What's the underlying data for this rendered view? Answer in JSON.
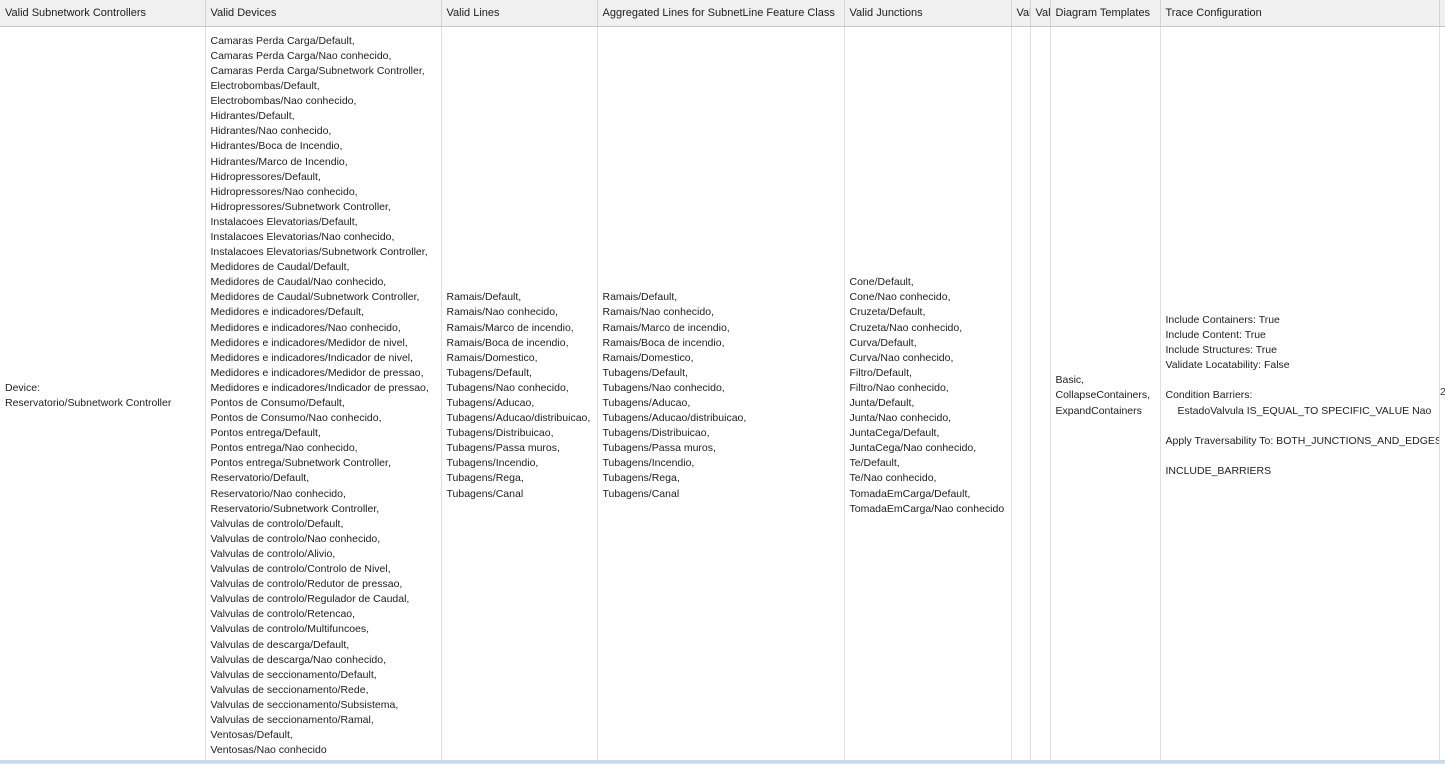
{
  "columns": [
    "Valid Subnetwork Controllers",
    "Valid Devices",
    "Valid Lines",
    "Aggregated Lines for SubnetLine Feature Class",
    "Valid Junctions",
    "Val",
    "Val",
    "Diagram Templates",
    "Trace Configuration",
    ""
  ],
  "row": {
    "subnetwork_controllers": [
      "Device:",
      "Reservatorio/Subnetwork Controller"
    ],
    "valid_devices": [
      "Camaras Perda Carga/Default,",
      "Camaras Perda Carga/Nao conhecido,",
      "Camaras Perda Carga/Subnetwork Controller,",
      "Electrobombas/Default,",
      "Electrobombas/Nao conhecido,",
      "Hidrantes/Default,",
      "Hidrantes/Nao conhecido,",
      "Hidrantes/Boca de Incendio,",
      "Hidrantes/Marco de Incendio,",
      "Hidropressores/Default,",
      "Hidropressores/Nao conhecido,",
      "Hidropressores/Subnetwork Controller,",
      "Instalacoes Elevatorias/Default,",
      "Instalacoes Elevatorias/Nao conhecido,",
      "Instalacoes Elevatorias/Subnetwork Controller,",
      "Medidores de Caudal/Default,",
      "Medidores de Caudal/Nao conhecido,",
      "Medidores de Caudal/Subnetwork Controller,",
      "Medidores e indicadores/Default,",
      "Medidores e indicadores/Nao conhecido,",
      "Medidores e indicadores/Medidor de nivel,",
      "Medidores e indicadores/Indicador de nivel,",
      "Medidores e indicadores/Medidor de pressao,",
      "Medidores e indicadores/Indicador de pressao,",
      "Pontos de Consumo/Default,",
      "Pontos de Consumo/Nao conhecido,",
      "Pontos entrega/Default,",
      "Pontos entrega/Nao conhecido,",
      "Pontos entrega/Subnetwork Controller,",
      "Reservatorio/Default,",
      "Reservatorio/Nao conhecido,",
      "Reservatorio/Subnetwork Controller,",
      "Valvulas de controlo/Default,",
      "Valvulas de controlo/Nao conhecido,",
      "Valvulas de controlo/Alivio,",
      "Valvulas de controlo/Controlo de Nivel,",
      "Valvulas de controlo/Redutor de pressao,",
      "Valvulas de controlo/Regulador de Caudal,",
      "Valvulas de controlo/Retencao,",
      "Valvulas de controlo/Multifuncoes,",
      "Valvulas de descarga/Default,",
      "Valvulas de descarga/Nao conhecido,",
      "Valvulas de seccionamento/Default,",
      "Valvulas de seccionamento/Rede,",
      "Valvulas de seccionamento/Subsistema,",
      "Valvulas de seccionamento/Ramal,",
      "Ventosas/Default,",
      "Ventosas/Nao conhecido"
    ],
    "valid_lines": [
      "Ramais/Default,",
      "Ramais/Nao conhecido,",
      "Ramais/Marco de incendio,",
      "Ramais/Boca de incendio,",
      "Ramais/Domestico,",
      "Tubagens/Default,",
      "Tubagens/Nao conhecido,",
      "Tubagens/Aducao,",
      "Tubagens/Aducao/distribuicao,",
      "Tubagens/Distribuicao,",
      "Tubagens/Passa muros,",
      "Tubagens/Incendio,",
      "Tubagens/Rega,",
      "Tubagens/Canal"
    ],
    "aggregated_lines": [
      "Ramais/Default,",
      "Ramais/Nao conhecido,",
      "Ramais/Marco de incendio,",
      "Ramais/Boca de incendio,",
      "Ramais/Domestico,",
      "Tubagens/Default,",
      "Tubagens/Nao conhecido,",
      "Tubagens/Aducao,",
      "Tubagens/Aducao/distribuicao,",
      "Tubagens/Distribuicao,",
      "Tubagens/Passa muros,",
      "Tubagens/Incendio,",
      "Tubagens/Rega,",
      "Tubagens/Canal"
    ],
    "valid_junctions": [
      "Cone/Default,",
      "Cone/Nao conhecido,",
      "Cruzeta/Default,",
      "Cruzeta/Nao conhecido,",
      "Curva/Default,",
      "Curva/Nao conhecido,",
      "Filtro/Default,",
      "Filtro/Nao conhecido,",
      "Junta/Default,",
      "Junta/Nao conhecido,",
      "JuntaCega/Default,",
      "JuntaCega/Nao conhecido,",
      "Te/Default,",
      "Te/Nao conhecido,",
      "TomadaEmCarga/Default,",
      "TomadaEmCarga/Nao conhecido"
    ],
    "diagram_templates": [
      "Basic,",
      "CollapseContainers,",
      "ExpandContainers"
    ],
    "trace_configuration": {
      "include_containers": "Include Containers: True",
      "include_content": "Include Content: True",
      "include_structures": "Include Structures: True",
      "validate_locatability": "Validate Locatability: False",
      "condition_barriers_label": "Condition Barriers:",
      "condition_barrier": "EstadoValvula IS_EQUAL_TO SPECIFIC_VALUE Nao",
      "apply_traversability": "Apply Traversability To: BOTH_JUNCTIONS_AND_EDGES",
      "include_barriers": "INCLUDE_BARRIERS"
    },
    "clipped_next": "2"
  }
}
